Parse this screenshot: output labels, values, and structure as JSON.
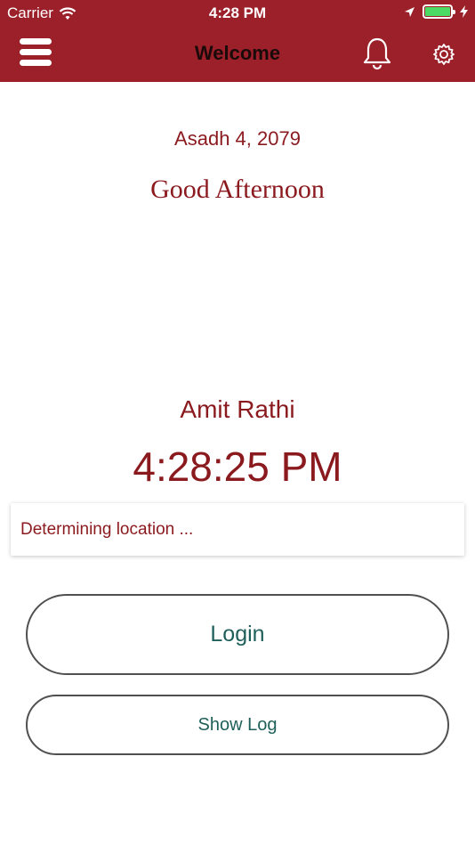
{
  "status_bar": {
    "carrier": "Carrier",
    "time": "4:28 PM",
    "battery_level": 1.0
  },
  "nav": {
    "title": "Welcome",
    "left_icon": "menu-icon",
    "right_icons": [
      "bell-icon",
      "gear-icon"
    ]
  },
  "main": {
    "date": "Asadh 4, 2079",
    "greeting": "Good Afternoon",
    "user_name": "Amit Rathi",
    "clock": "4:28:25 PM",
    "location_status": "Determining location ..."
  },
  "buttons": {
    "login_label": "Login",
    "show_log_label": "Show Log"
  },
  "colors": {
    "brand": "#9b2029",
    "text_accent": "#8b1a1f",
    "button_text": "#1f5f5a"
  }
}
